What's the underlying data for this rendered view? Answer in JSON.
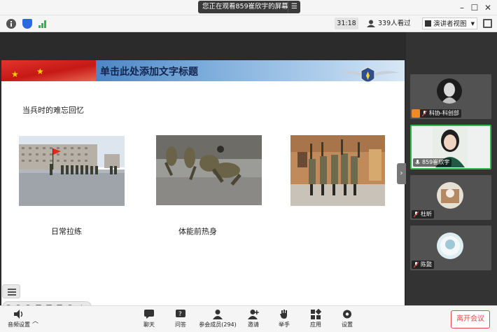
{
  "title_bar": {
    "banner_text": "您正在观看859崔欣宇的屏幕",
    "menu_icon": "list-icon",
    "window_controls": [
      "minimize-icon",
      "maximize-icon",
      "close-icon"
    ]
  },
  "toolbar": {
    "left_icons": [
      "info-icon",
      "shield-icon",
      "signal-icon"
    ],
    "timer": "31:18",
    "viewers": "339人看过",
    "view_mode": "演讲者视图",
    "fullscreen_icon": "fullscreen-icon"
  },
  "slide": {
    "title": "单击此处添加文字标题",
    "subtitle": "当兵时的难忘回忆",
    "captions": [
      "日常拉练",
      "体能前热身"
    ]
  },
  "participants": [
    {
      "name": "科协-科创部",
      "mic": "muted"
    },
    {
      "name": "859崔欣宇",
      "mic": "active"
    },
    {
      "name": "杜昕",
      "mic": "muted"
    },
    {
      "name": "陈懿",
      "mic": "muted"
    }
  ],
  "bottom_bar": {
    "audio_label": "音频设置",
    "items": [
      {
        "label": "聊天",
        "icon": "chat-icon"
      },
      {
        "label": "问答",
        "icon": "qa-icon"
      },
      {
        "label": "参会成员(294)",
        "icon": "members-icon"
      },
      {
        "label": "邀请",
        "icon": "invite-icon"
      },
      {
        "label": "举手",
        "icon": "raise-hand-icon"
      },
      {
        "label": "应用",
        "icon": "apps-icon"
      },
      {
        "label": "设置",
        "icon": "settings-icon"
      }
    ],
    "leave_label": "离开会议"
  },
  "colors": {
    "active_speaker_border": "#2db84d",
    "leave_red": "#e04a4a",
    "muted_mic": "#e04a4a"
  }
}
